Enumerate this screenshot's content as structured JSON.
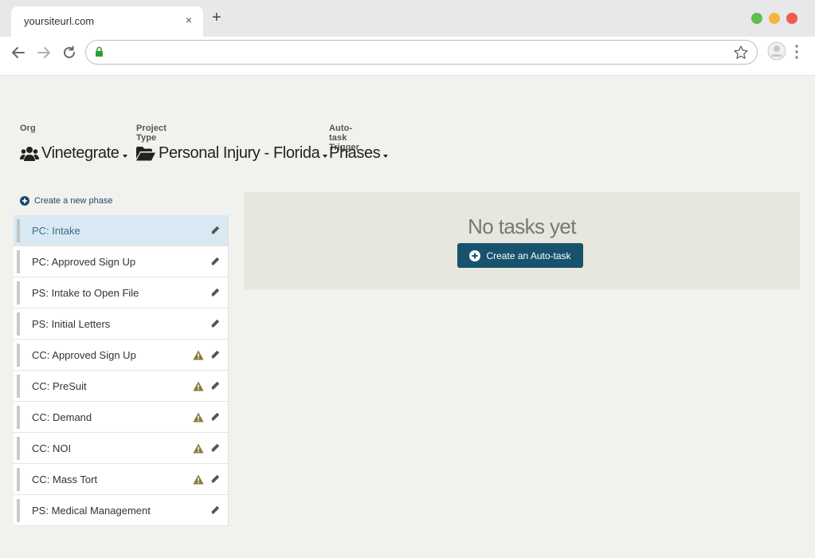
{
  "browser": {
    "tab_title": "yoursiteurl.com",
    "tab_close": "×",
    "new_tab": "+",
    "url": ""
  },
  "selectors": {
    "org": {
      "label": "Org",
      "value": "Vinetegrate",
      "icon": "users-icon"
    },
    "project_type": {
      "label": "Project Type",
      "value": "Personal Injury - Florida",
      "icon": "folder-open-icon"
    },
    "trigger": {
      "label": "Auto-task Trigger",
      "value": "Phases"
    }
  },
  "create_phase_label": "Create a new phase",
  "phases": [
    {
      "label": "PC: Intake",
      "active": true,
      "warning": false
    },
    {
      "label": "PC: Approved Sign Up",
      "active": false,
      "warning": false
    },
    {
      "label": "PS: Intake to Open File",
      "active": false,
      "warning": false
    },
    {
      "label": "PS: Initial Letters",
      "active": false,
      "warning": false
    },
    {
      "label": "CC: Approved Sign Up",
      "active": false,
      "warning": true
    },
    {
      "label": "CC: PreSuit",
      "active": false,
      "warning": true
    },
    {
      "label": "CC: Demand",
      "active": false,
      "warning": true
    },
    {
      "label": "CC: NOI",
      "active": false,
      "warning": true
    },
    {
      "label": "CC: Mass Tort",
      "active": false,
      "warning": true
    },
    {
      "label": "PS: Medical Management",
      "active": false,
      "warning": false
    }
  ],
  "tasks": {
    "empty_text": "No tasks yet",
    "create_button": "Create an Auto-task"
  },
  "colors": {
    "accent": "#17536c",
    "active_row": "#d9e9f3",
    "warning": "#8a7a3a"
  }
}
